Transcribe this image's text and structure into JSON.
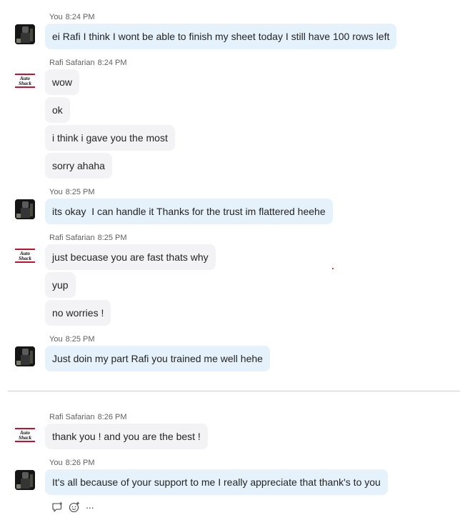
{
  "conversation": {
    "groups": [
      {
        "sender": "You",
        "time": "8:24 PM",
        "avatar": "you-avatar-photo",
        "messages": [
          "ei Rafi I think I wont be able to finish my sheet today I still have 100 rows left"
        ]
      },
      {
        "sender": "Rafi Safarian",
        "time": "8:24 PM",
        "avatar": "auto-shack-logo",
        "avatar_logo_text": "Auto Shack",
        "messages": [
          "wow",
          "ok",
          "i think i gave you the most",
          "sorry ahaha"
        ]
      },
      {
        "sender": "You",
        "time": "8:25 PM",
        "avatar": "you-avatar-photo",
        "messages": [
          "its okay  I can handle it Thanks for the trust im flattered heehe"
        ]
      },
      {
        "sender": "Rafi Safarian",
        "time": "8:25 PM",
        "avatar": "auto-shack-logo",
        "avatar_logo_text": "Auto Shack",
        "messages": [
          "just becuase you are fast thats why",
          "yup",
          "no worries !"
        ]
      },
      {
        "sender": "You",
        "time": "8:25 PM",
        "avatar": "you-avatar-photo",
        "messages": [
          "Just doin my part Rafi you trained me well hehe"
        ]
      },
      {
        "sender": "Rafi Safarian",
        "time": "8:26 PM",
        "avatar": "auto-shack-logo",
        "avatar_logo_text": "Auto Shack",
        "messages": [
          "thank you ! and you are the best !"
        ]
      },
      {
        "sender": "You",
        "time": "8:26 PM",
        "avatar": "you-avatar-photo",
        "messages": [
          "It's all because of your support to me I really appreciate that thank's to you"
        ]
      }
    ]
  },
  "actions": {
    "icons": [
      "reply-icon",
      "emoji-reaction-icon",
      "more-options-icon"
    ],
    "more_label": "..."
  },
  "colors": {
    "my_bubble": "#e5f1fb",
    "their_bubble": "#f3f3f5",
    "meta_text": "#616161",
    "divider": "#e8c4c4",
    "logo_red": "#c8102e"
  }
}
